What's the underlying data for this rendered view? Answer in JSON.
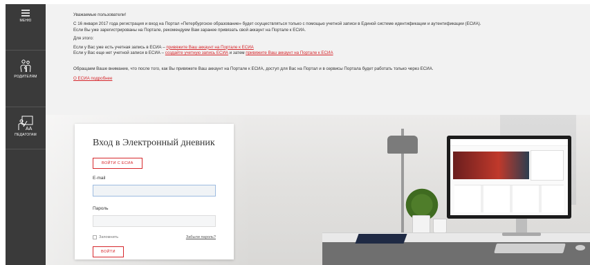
{
  "sidebar": {
    "menu_label": "МЕНЮ",
    "parents_label": "РОДИТЕЛЯМ",
    "teachers_label": "ПЕДАГОГАМ",
    "teachers_icon_text": "AA"
  },
  "notice": {
    "greeting": "Уважаемые пользователи!",
    "line1": "С 16 января 2017 года регистрация и вход на Портал «Петербургское образование» будет осуществляться только с помощью учетной записи в Единой системе идентификации и аутентификации (ЕСИА).",
    "line2": "Если Вы уже зарегистрированы на Портале, рекомендуем Вам заранее привязать свой аккаунт на Портале к ЕСИА.",
    "for_this": "Для этого:",
    "has_account_text": "Если у Вас уже есть учетная запись в ЕСИА – ",
    "has_account_link": "привяжите Ваш аккаунт на Портале к ЕСИА",
    "no_account_text": "Если у Вас еще нет учетной записи в ЕСИА – ",
    "create_link": "создайте учетную запись ЕСИА",
    "and_then": " и затем ",
    "bind_link": "привяжите Ваш аккаунт на Портале к ЕСИА",
    "attention": "Обращаем Ваше внимание, что после того, как Вы привяжете Ваш аккаунт на Портале к ЕСИА, доступ для Вас на Портал и в сервисы Портала будет работать только через ЕСИА.",
    "more_link": "О ЕСИА подробнее"
  },
  "login": {
    "title": "Вход в Электронный дневник",
    "esia_button": "ВОЙТИ С ЕСИА",
    "email_label": "E-mail",
    "email_value": "",
    "password_label": "Пароль",
    "password_value": "",
    "remember_label": "Запомнить",
    "forgot_link": "Забыли пароль?",
    "submit_button": "ВОЙТИ"
  },
  "colors": {
    "accent": "#d6262b",
    "sidebar": "#3a3a3a",
    "notice_bg": "#f2f2f2"
  }
}
